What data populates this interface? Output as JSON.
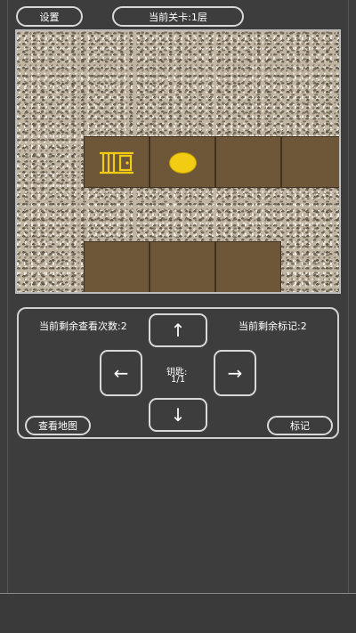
{
  "header": {
    "settings_label": "设置",
    "level_label": "当前关卡:1层"
  },
  "controls": {
    "views_remaining": "当前剩余查看次数:2",
    "marks_remaining": "当前剩余标记:2",
    "key_label": "钥匙:",
    "key_count": "1/1",
    "up": "↑",
    "down": "↓",
    "left": "←",
    "right": "→",
    "view_map_label": "查看地图",
    "mark_label": "标记"
  },
  "map": {
    "items": {
      "gate": "gate-icon",
      "coin": "coin-icon"
    }
  },
  "colors": {
    "background": "#3d3d3d",
    "floor": "#6e5738",
    "coin": "#f2cc12",
    "gate": "#f2cc12"
  }
}
